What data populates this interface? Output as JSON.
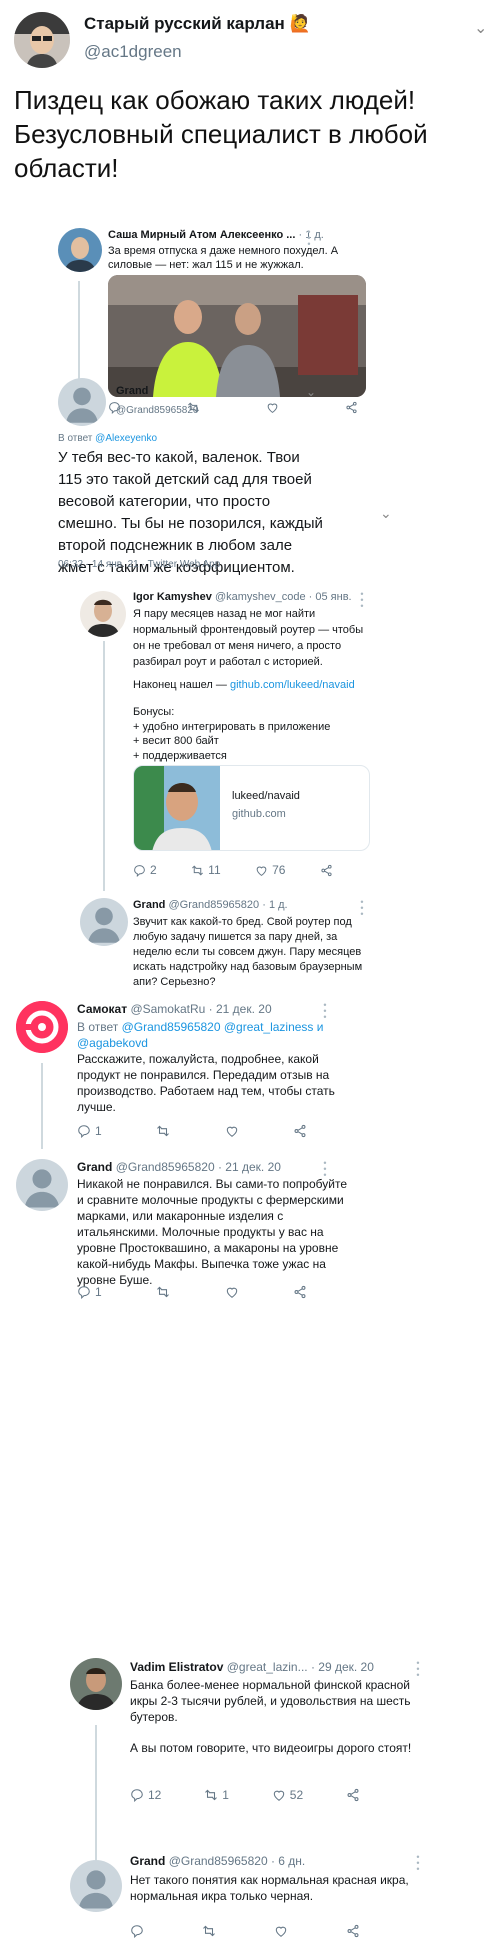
{
  "header": {
    "display_name": "Старый русский карлан",
    "name_emoji": "🙋",
    "handle": "@ac1dgreen",
    "text": "Пиздец как обожаю таких людей! Безусловный специалист в любой области!"
  },
  "post1": {
    "name": "Саша Мирный Атом Алексеенко ...",
    "time": "· 1 д.",
    "text": "За время отпуска я даже немного похудел. А силовые — нет: жал 115 и не жужжал."
  },
  "grand_main": {
    "name": "Grand",
    "handle": "@Grand85965820",
    "reply_prefix": "В ответ",
    "reply_to": "@Alexeyenko",
    "text": "У тебя вес-то какой, валенок. Твои 115 это такой детский сад для твоей весовой категории, что просто смешно. Ты бы не позорился, каждый второй подснежник в любом зале жмет с таким же коэффициентом.",
    "meta": "06:32 · 14 янв. 21 · Twitter Web App"
  },
  "igor": {
    "name": "Igor Kamyshev",
    "handle": "@kamyshev_code",
    "time": "· 05 янв.",
    "p1": "Я пару месяцев назад не мог найти нормальный фронтендовый роутер — чтобы он не требовал от меня ничего, а просто разбирал роут и работал с историей.",
    "p2_prefix": "Наконец нашел — ",
    "p2_link": "github.com/lukeed/navaid",
    "bonus_title": "Бонусы:",
    "bonus_1": "+ удобно интегрировать в приложение",
    "bonus_2": "+ весит 800 байт",
    "bonus_3": "+ поддерживается",
    "card_title": "lukeed/navaid",
    "card_domain": "github.com",
    "replies": "2",
    "retweets": "11",
    "likes": "76"
  },
  "grand2": {
    "name": "Grand",
    "handle": "@Grand85965820",
    "time": "· 1 д.",
    "text": "Звучит как какой-то бред. Свой роутер под любую задачу пишется за пару дней, за неделю если ты совсем джун. Пару месяцев искать надстройку над базовым браузерным апи? Серьезно?"
  },
  "samokat": {
    "name": "Самокат",
    "handle": "@SamokatRu",
    "time": "· 21 дек. 20",
    "reply_prefix": "В ответ",
    "reply_to": "@Grand85965820 @great_laziness и @agabekovd",
    "text": "Расскажите, пожалуйста, подробнее, какой продукт не понравился. Передадим отзыв на производство. Работаем над тем, чтобы стать лучше.",
    "replies": "1"
  },
  "grand3": {
    "name": "Grand",
    "handle": "@Grand85965820",
    "time": "· 21 дек. 20",
    "text": "Никакой не понравился. Вы сами-то попробуйте и сравните молочные продукты с фермерскими марками, или макаронные изделия с итальянскими. Молочные продукты у вас на уровне Простоквашино, а макароны на уровне какой-нибудь Макфы. Выпечка тоже ужас на уровне Буше.",
    "replies": "1"
  },
  "vadim": {
    "name": "Vadim Elistratov",
    "handle": "@great_lazin...",
    "time": "· 29 дек. 20",
    "p1": "Банка более-менее нормальной финской красной икры 2-3 тысячи рублей, и удовольствия на шесть бутеров.",
    "p2": "А вы потом говорите, что видеоигры дорого стоят!",
    "replies": "12",
    "retweets": "1",
    "likes": "52"
  },
  "grand4": {
    "name": "Grand",
    "handle": "@Grand85965820",
    "time": "· 6 дн.",
    "text": "Нет такого понятия как нормальная красная икра, нормальная икра только черная."
  },
  "colors": {
    "link": "#1b95e0",
    "samokat": "#ff335f",
    "gray": "#657786"
  }
}
